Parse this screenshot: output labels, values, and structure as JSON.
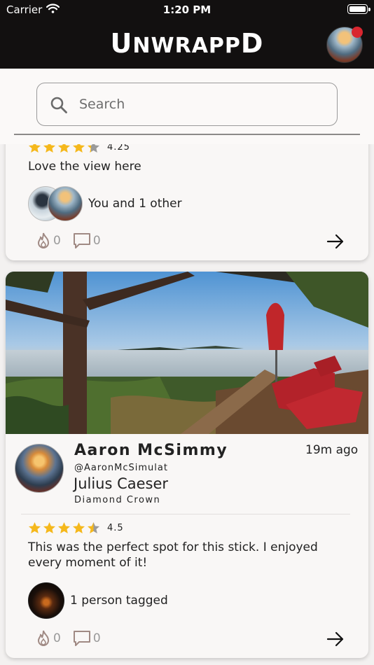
{
  "status_bar": {
    "carrier": "Carrier",
    "time": "1:20 PM"
  },
  "header": {
    "logo_first": "U",
    "logo_rest": "NWRAPP",
    "logo_last": "D"
  },
  "search": {
    "placeholder": "Search"
  },
  "colors": {
    "header_bg": "#121010",
    "star": "#f5b81c",
    "star_empty": "#9a9a9a",
    "notification": "#d9262f",
    "accent_icon": "#a08a84"
  },
  "icons": [
    "wifi-icon",
    "battery-icon",
    "search-icon",
    "flame-icon",
    "comment-icon",
    "arrow-right-icon",
    "star-icon"
  ],
  "posts": [
    {
      "rating": "4.25",
      "rating_value": 4.25,
      "caption": "Love the view here",
      "tagged_text": "You and 1 other",
      "likes": "0",
      "comments": "0"
    },
    {
      "user_name": "Aaron McSimmy",
      "handle": "@AaronMcSimulat",
      "time_ago": "19m ago",
      "cigar_name": "Julius Caeser",
      "brand": "Diamond Crown",
      "rating": "4.5",
      "rating_value": 4.5,
      "caption": "This was the perfect spot for this stick. I enjoyed every moment of it!",
      "tagged_text": "1 person tagged",
      "likes": "0",
      "comments": "0"
    }
  ]
}
